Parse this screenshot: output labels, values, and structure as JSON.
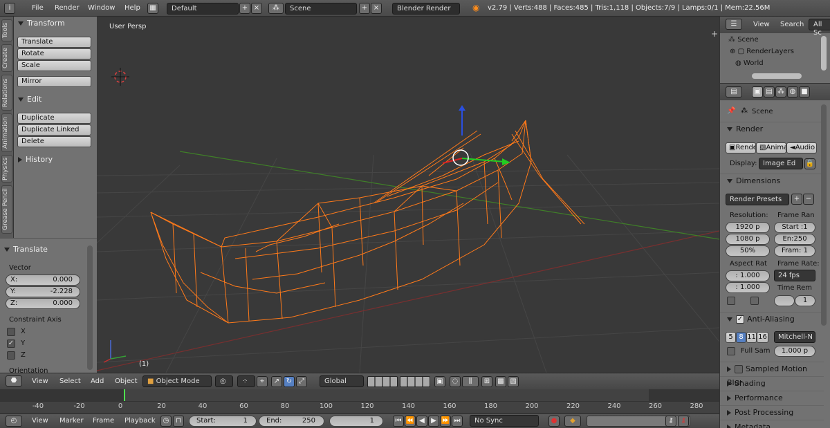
{
  "topbar": {
    "menus": [
      "File",
      "Render",
      "Window",
      "Help"
    ],
    "screen_layout": "Default",
    "scene": "Scene",
    "render_engine": "Blender Render",
    "stats": "v2.79 | Verts:488 | Faces:485 | Tris:1,118 | Objects:7/9 | Lamps:0/1 | Mem:22.56M"
  },
  "vertical_tabs": [
    "Tools",
    "Create",
    "Relations",
    "Animation",
    "Physics",
    "Grease Pencil"
  ],
  "toolshelf": {
    "transform_header": "Transform",
    "translate": "Translate",
    "rotate": "Rotate",
    "scale": "Scale",
    "mirror": "Mirror",
    "edit_header": "Edit",
    "duplicate": "Duplicate",
    "duplicate_linked": "Duplicate Linked",
    "delete": "Delete",
    "history_header": "History"
  },
  "operator_panel": {
    "header": "Translate",
    "vector_label": "Vector",
    "x_label": "X:",
    "x_value": "0.000",
    "y_label": "Y:",
    "y_value": "-2.228",
    "z_label": "Z:",
    "z_value": "0.000",
    "constraint_label": "Constraint Axis",
    "cx": "X",
    "cy": "Y",
    "cz": "Z",
    "orientation_label": "Orientation"
  },
  "viewport": {
    "view_name": "User Persp",
    "frame_indicator": "(1)",
    "colors": {
      "wire": "#ff7a1a",
      "x_axis": "#8a3030",
      "y_axis": "#4a8a2a",
      "grid": "#4a4a4a"
    }
  },
  "viewport_header": {
    "menus": [
      "View",
      "Select",
      "Add",
      "Object"
    ],
    "mode": "Object Mode",
    "orientation": "Global"
  },
  "timeline": {
    "ticks": [
      "-40",
      "-20",
      "0",
      "20",
      "40",
      "60",
      "80",
      "100",
      "120",
      "140",
      "160",
      "180",
      "200",
      "220",
      "240",
      "260",
      "280"
    ],
    "menus": [
      "View",
      "Marker",
      "Frame",
      "Playback"
    ],
    "start": "Start:",
    "start_value": "1",
    "end": "End:",
    "end_value": "250",
    "current": "1",
    "sync": "No Sync"
  },
  "outliner": {
    "view": "View",
    "search": "Search",
    "filter": "All Sc",
    "items": [
      "Scene",
      "RenderLayers",
      "World"
    ]
  },
  "properties": {
    "context": "Scene",
    "render_header": "Render",
    "render_btn": "Rende",
    "anim_btn": "Anima",
    "audio_btn": "Audio",
    "display_label": "Display:",
    "display_value": "Image Ed",
    "dimensions_header": "Dimensions",
    "render_presets": "Render Presets",
    "resolution_label": "Resolution:",
    "res_x": "1920 p",
    "res_y": "1080 p",
    "res_pct": "50%",
    "frame_range_label": "Frame Ran",
    "frame_start": "Start :1",
    "frame_end": "En:250",
    "frame_step": "Fram: 1",
    "aspect_label": "Aspect Rat",
    "aspect_x": ": 1.000",
    "aspect_y": ": 1.000",
    "frame_rate_label": "Frame Rate:",
    "frame_rate": "24 fps",
    "time_remap_label": "Time Rem",
    "time_remap": "1",
    "aa_header": "Anti-Aliasing",
    "aa_samples": [
      "5",
      "8",
      "11",
      "16"
    ],
    "aa_filter": "Mitchell-N",
    "full_sample": "Full Sam",
    "filter_size": "1.000 p",
    "motion_blur": "Sampled Motion Blur",
    "shading": "Shading",
    "performance": "Performance",
    "post_processing": "Post Processing",
    "metadata": "Metadata"
  }
}
